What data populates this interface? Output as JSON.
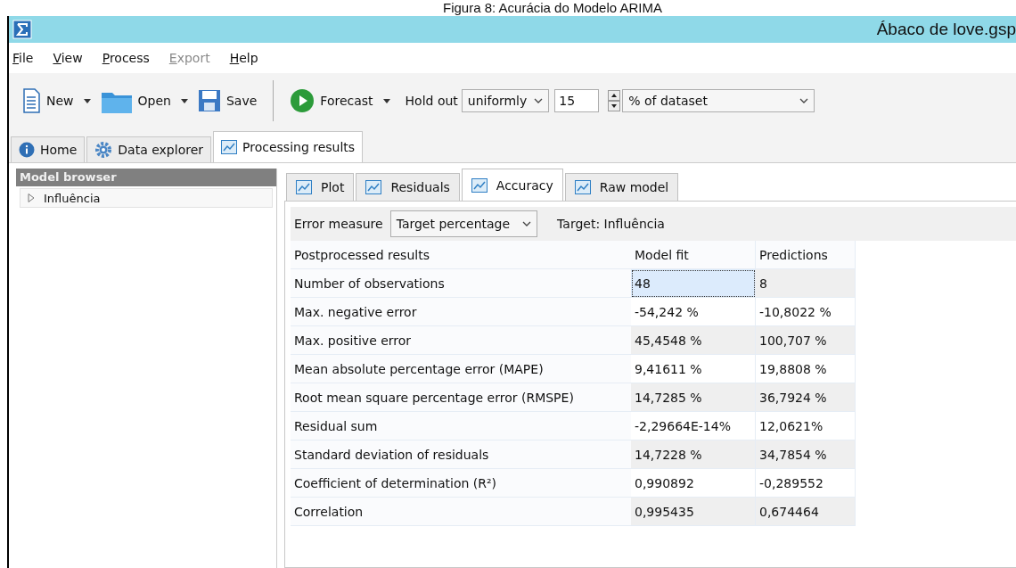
{
  "caption": "Figura 8: Acurácia do Modelo ARIMA",
  "window": {
    "title": "Ábaco de love.gsp"
  },
  "menu": [
    {
      "label": "File",
      "disabled": false
    },
    {
      "label": "View",
      "disabled": false
    },
    {
      "label": "Process",
      "disabled": false
    },
    {
      "label": "Export",
      "disabled": true
    },
    {
      "label": "Help",
      "disabled": false
    }
  ],
  "toolbar": {
    "buttons": [
      {
        "label": "New",
        "kind": "new",
        "dropdown": true
      },
      {
        "label": "Open",
        "kind": "open",
        "dropdown": true
      },
      {
        "label": "Save",
        "kind": "save",
        "dropdown": false
      },
      {
        "label": "Forecast",
        "kind": "forecast",
        "dropdown": true
      }
    ],
    "holdout_label": "Hold out",
    "holdout_mode": "uniformly",
    "holdout_value": "15",
    "holdout_unit": "% of dataset"
  },
  "tabs": [
    {
      "label": "Home",
      "kind": "info",
      "selected": false
    },
    {
      "label": "Data explorer",
      "kind": "gear",
      "selected": false
    },
    {
      "label": "Processing results",
      "kind": "chart",
      "selected": true
    }
  ],
  "sidebar": {
    "title": "Model browser",
    "items": [
      {
        "label": "Influência",
        "expanded": false
      }
    ]
  },
  "subtabs": [
    {
      "label": "Plot",
      "selected": false
    },
    {
      "label": "Residuals",
      "selected": false
    },
    {
      "label": "Accuracy",
      "selected": true
    },
    {
      "label": "Raw model",
      "selected": false
    }
  ],
  "filter": {
    "label": "Error measure",
    "value": "Target percentage",
    "target": "Target: Influência"
  },
  "table": {
    "columns": [
      "Postprocessed results",
      "Model fit",
      "Predictions"
    ],
    "rows": [
      {
        "label": "Number of observations",
        "values": [
          {
            "text": "48",
            "selected": true
          },
          {
            "text": "8",
            "selected": false
          }
        ]
      },
      {
        "label": "Max. negative error",
        "values": [
          {
            "text": "-54,242 %",
            "selected": false
          },
          {
            "text": "-10,8022 %",
            "selected": false
          }
        ]
      },
      {
        "label": "Max. positive error",
        "values": [
          {
            "text": "45,4548 %",
            "selected": false
          },
          {
            "text": "100,707 %",
            "selected": false
          }
        ]
      },
      {
        "label": "Mean absolute percentage error (MAPE)",
        "values": [
          {
            "text": "9,41611 %",
            "selected": false
          },
          {
            "text": "19,8808 %",
            "selected": false
          }
        ]
      },
      {
        "label": "Root mean square percentage error (RMSPE)",
        "values": [
          {
            "text": "14,7285 %",
            "selected": false
          },
          {
            "text": "36,7924 %",
            "selected": false
          }
        ]
      },
      {
        "label": "Residual sum",
        "values": [
          {
            "text": "-2,29664E-14%",
            "selected": false
          },
          {
            "text": "12,0621%",
            "selected": false
          }
        ]
      },
      {
        "label": "Standard deviation of residuals",
        "values": [
          {
            "text": "14,7228 %",
            "selected": false
          },
          {
            "text": "34,7854 %",
            "selected": false
          }
        ]
      },
      {
        "label": "Coefficient of determination (R²)",
        "values": [
          {
            "text": "0,990892",
            "selected": false
          },
          {
            "text": "-0,289552",
            "selected": false
          }
        ]
      },
      {
        "label": "Correlation",
        "values": [
          {
            "text": "0,995435",
            "selected": false
          },
          {
            "text": "0,674464",
            "selected": false
          }
        ]
      }
    ]
  }
}
